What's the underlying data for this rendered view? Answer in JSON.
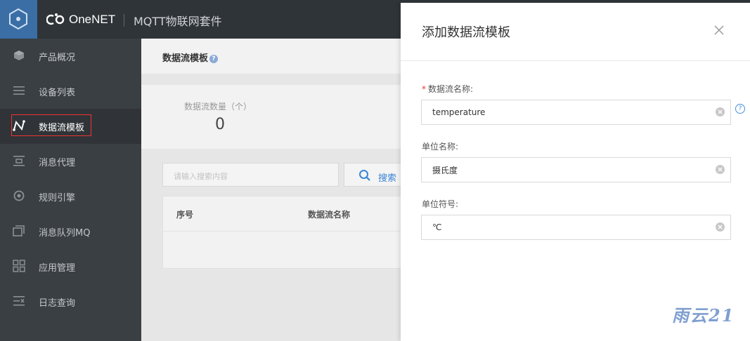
{
  "header": {
    "brand": "OneNET",
    "product": "MQTT物联网套件"
  },
  "sidebar": {
    "items": [
      {
        "label": "产品概况",
        "icon": "cube-icon"
      },
      {
        "label": "设备列表",
        "icon": "list-icon"
      },
      {
        "label": "数据流模板",
        "icon": "data-stream-icon"
      },
      {
        "label": "消息代理",
        "icon": "message-proxy-icon"
      },
      {
        "label": "规则引擎",
        "icon": "rule-engine-icon"
      },
      {
        "label": "消息队列MQ",
        "icon": "queue-icon"
      },
      {
        "label": "应用管理",
        "icon": "grid-icon"
      },
      {
        "label": "日志查询",
        "icon": "log-icon"
      }
    ],
    "active_index": 2
  },
  "main": {
    "title": "数据流模板",
    "help": "?",
    "stat": {
      "label": "数据流数量（个）",
      "value": "0"
    },
    "search": {
      "placeholder": "请输入搜索内容",
      "button": "搜索"
    },
    "table": {
      "columns": [
        "序号",
        "数据流名称"
      ]
    }
  },
  "panel": {
    "title": "添加数据流模板",
    "fields": [
      {
        "label": "数据流名称:",
        "required": true,
        "value": "temperature"
      },
      {
        "label": "单位名称:",
        "required": false,
        "value": "摄氏度"
      },
      {
        "label": "单位符号:",
        "required": false,
        "value": "℃"
      }
    ],
    "required_mark": "*",
    "help": "?"
  },
  "watermark": "雨云21",
  "colors": {
    "topbar": "#2f3438",
    "sidebar": "#3a3f44",
    "accent": "#3a84d6",
    "required": "#e33333"
  }
}
